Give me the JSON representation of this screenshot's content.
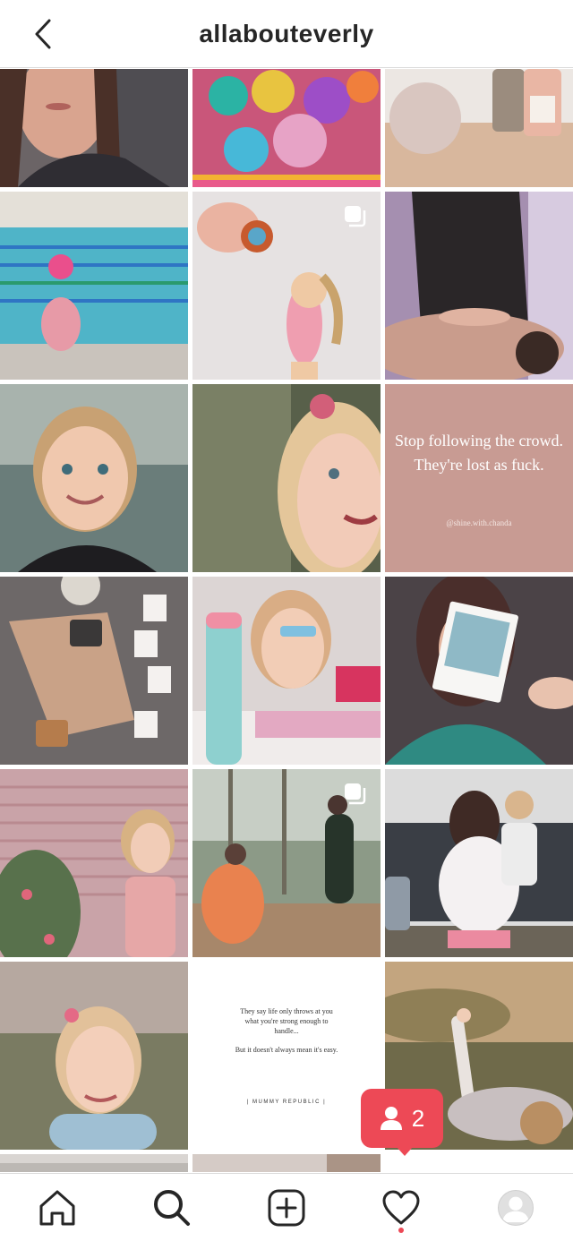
{
  "header": {
    "username": "allabouteverly"
  },
  "grid": {
    "quote_post": {
      "line1": "Stop following the crowd.",
      "line2": "They're lost as fuck.",
      "handle": "@shine.with.chanda"
    },
    "text_post": {
      "line1": "They say life only throws at you what you're strong enough to handle...",
      "line2": "But it doesn't always mean it's easy.",
      "brand": "| MUMMY REPUBLIC |"
    }
  },
  "activity_toast": {
    "count": "2",
    "icon": "person-icon"
  },
  "tabbar": {
    "items": [
      "home-icon",
      "search-icon",
      "new-post-icon",
      "activity-heart-icon",
      "profile-avatar"
    ]
  },
  "colors": {
    "accent": "#ed4956",
    "quote_bg": "#c89b93",
    "border": "#dbdbdb",
    "text": "#262626"
  }
}
